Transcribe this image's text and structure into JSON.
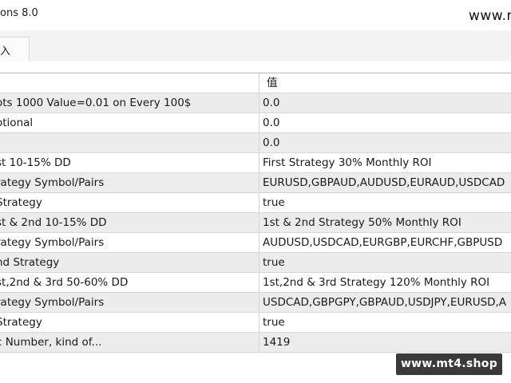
{
  "window": {
    "title": "ons 8.0",
    "watermark_top": "www.m"
  },
  "tabs": [
    {
      "label": "入"
    }
  ],
  "grid": {
    "header": {
      "name": "",
      "value": "值"
    },
    "rows": [
      {
        "name": "ots 1000 Value=0.01 on Every 100$",
        "value": "0.0"
      },
      {
        "name": "otional",
        "value": "0.0"
      },
      {
        "name": "",
        "value": "0.0"
      },
      {
        "name": "st 10-15% DD",
        "value": "First Strategy 30% Monthly ROI"
      },
      {
        "name": "rategy Symbol/Pairs",
        "value": "EURUSD,GBPAUD,AUDUSD,EURAUD,USDCAD"
      },
      {
        "name": "Strategy",
        "value": "true"
      },
      {
        "name": "st & 2nd 10-15% DD",
        "value": "1st & 2nd Strategy 50% Monthly ROI"
      },
      {
        "name": "rategy Symbol/Pairs",
        "value": "AUDUSD,USDCAD,EURGBP,EURCHF,GBPUSD"
      },
      {
        "name": "nd Strategy",
        "value": "true"
      },
      {
        "name": "st,2nd & 3rd 50-60% DD",
        "value": "1st,2nd & 3rd Strategy 120% Monthly ROI"
      },
      {
        "name": "rategy Symbol/Pairs",
        "value": "USDCAD,GBPGPY,GBPAUD,USDJPY,EURUSD,A"
      },
      {
        "name": "Strategy",
        "value": "true"
      },
      {
        "name": "c Number, kind of...",
        "value": "1419"
      }
    ]
  },
  "watermark_badge": "www.mt4.shop"
}
